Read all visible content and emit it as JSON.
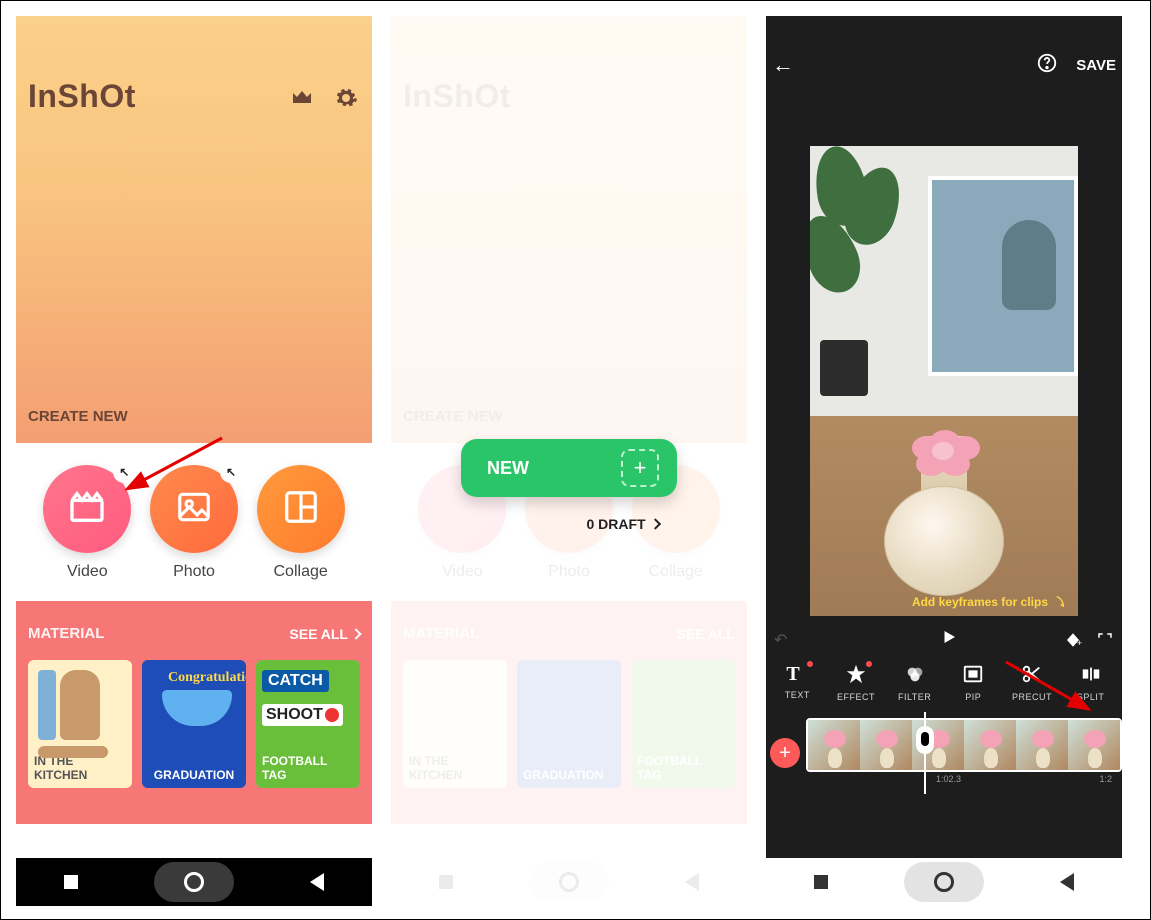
{
  "panel1": {
    "brand": "InShOt",
    "create_new": "CREATE NEW",
    "actions": {
      "video": "Video",
      "photo": "Photo",
      "collage": "Collage"
    },
    "material": {
      "title": "MATERIAL",
      "see_all": "SEE ALL",
      "tiles": [
        {
          "label": "IN THE KITCHEN"
        },
        {
          "label": "GRADUATION",
          "script": "Congratulations!"
        },
        {
          "label": "FOOTBALL TAG",
          "b1": "CATCH",
          "b2": "SHOOT"
        }
      ]
    }
  },
  "panel2": {
    "new_label": "NEW",
    "draft_label": "0 DRAFT"
  },
  "panel3": {
    "save": "SAVE",
    "hint": "Add keyframes for clips",
    "tools": {
      "text": "TEXT",
      "effect": "EFFECT",
      "filter": "FILTER",
      "pip": "PIP",
      "precut": "PRECUT",
      "split": "SPLIT"
    },
    "time_current": "1:02.3",
    "time_right": "1:2"
  }
}
